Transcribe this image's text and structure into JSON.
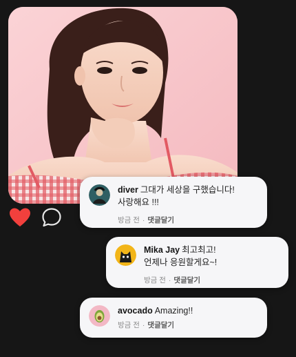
{
  "post": {
    "photo_icon": "portrait-photo",
    "colors": {
      "background": "#161616",
      "photo_bg": "#f7c3c7",
      "heart": "#f2403d",
      "bubble": "#f6f6f8"
    }
  },
  "reactions": {
    "like_icon": "heart-icon",
    "comment_icon": "comment-icon"
  },
  "comments": [
    {
      "username": "diver",
      "text": "그대가 세상을 구했습니다!",
      "text2": "사랑해요 !!!",
      "time": "방금 전",
      "separator": "·",
      "reply_label": "댓글달기",
      "avatar_icon": "diver-avatar"
    },
    {
      "username": "Mika Jay",
      "text": "최고최고!",
      "text2": "언제나 응원할게요~!",
      "time": "방금 전",
      "separator": "·",
      "reply_label": "댓글달기",
      "avatar_icon": "cat-avatar"
    },
    {
      "username": "avocado",
      "text": "Amazing!!",
      "time": "방금 전",
      "separator": "·",
      "reply_label": "댓글달기",
      "avatar_icon": "avocado-avatar"
    }
  ]
}
